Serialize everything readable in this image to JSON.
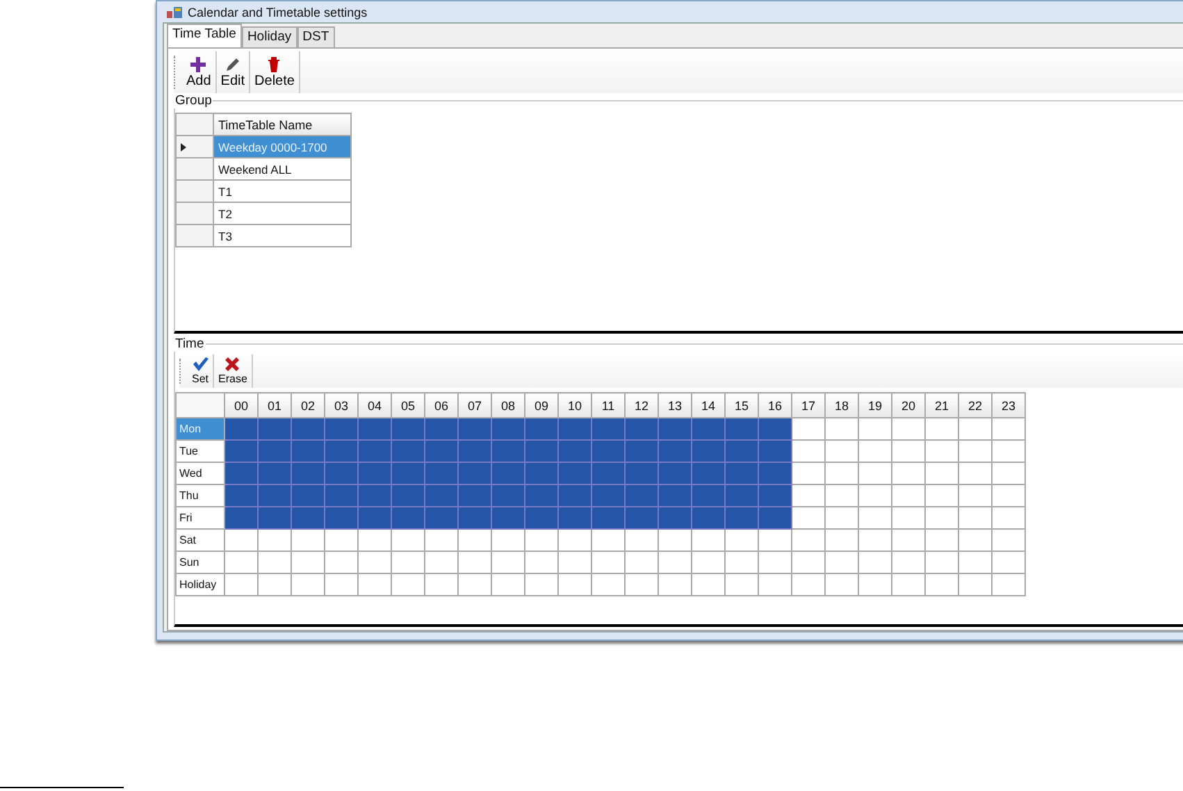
{
  "window": {
    "title": "Calendar and Timetable settings"
  },
  "tabs": [
    {
      "label": "Time Table",
      "selected": true
    },
    {
      "label": "Holiday",
      "selected": false
    },
    {
      "label": "DST",
      "selected": false
    }
  ],
  "toolbar": [
    {
      "kind": "add",
      "label": "Add"
    },
    {
      "kind": "edit",
      "label": "Edit"
    },
    {
      "kind": "delete",
      "label": "Delete"
    }
  ],
  "group": {
    "title": "Group",
    "column": "TimeTable Name",
    "rows": [
      {
        "name": "Weekday 0000-1700",
        "selected": true
      },
      {
        "name": "Weekend ALL",
        "selected": false
      },
      {
        "name": "T1",
        "selected": false
      },
      {
        "name": "T2",
        "selected": false
      },
      {
        "name": "T3",
        "selected": false
      }
    ]
  },
  "time": {
    "title": "Time",
    "toolbar": [
      {
        "kind": "set",
        "label": "Set"
      },
      {
        "kind": "erase",
        "label": "Erase"
      }
    ],
    "hours": [
      "00",
      "01",
      "02",
      "03",
      "04",
      "05",
      "06",
      "07",
      "08",
      "09",
      "10",
      "11",
      "12",
      "13",
      "14",
      "15",
      "16",
      "17",
      "18",
      "19",
      "20",
      "21",
      "22",
      "23"
    ],
    "days": [
      {
        "name": "Mon",
        "selected": true,
        "slots": [
          true,
          true,
          true,
          true,
          true,
          true,
          true,
          true,
          true,
          true,
          true,
          true,
          true,
          true,
          true,
          true,
          true,
          false,
          false,
          false,
          false,
          false,
          false,
          false
        ]
      },
      {
        "name": "Tue",
        "selected": false,
        "slots": [
          true,
          true,
          true,
          true,
          true,
          true,
          true,
          true,
          true,
          true,
          true,
          true,
          true,
          true,
          true,
          true,
          true,
          false,
          false,
          false,
          false,
          false,
          false,
          false
        ]
      },
      {
        "name": "Wed",
        "selected": false,
        "slots": [
          true,
          true,
          true,
          true,
          true,
          true,
          true,
          true,
          true,
          true,
          true,
          true,
          true,
          true,
          true,
          true,
          true,
          false,
          false,
          false,
          false,
          false,
          false,
          false
        ]
      },
      {
        "name": "Thu",
        "selected": false,
        "slots": [
          true,
          true,
          true,
          true,
          true,
          true,
          true,
          true,
          true,
          true,
          true,
          true,
          true,
          true,
          true,
          true,
          true,
          false,
          false,
          false,
          false,
          false,
          false,
          false
        ]
      },
      {
        "name": "Fri",
        "selected": false,
        "slots": [
          true,
          true,
          true,
          true,
          true,
          true,
          true,
          true,
          true,
          true,
          true,
          true,
          true,
          true,
          true,
          true,
          true,
          false,
          false,
          false,
          false,
          false,
          false,
          false
        ]
      },
      {
        "name": "Sat",
        "selected": false,
        "slots": [
          false,
          false,
          false,
          false,
          false,
          false,
          false,
          false,
          false,
          false,
          false,
          false,
          false,
          false,
          false,
          false,
          false,
          false,
          false,
          false,
          false,
          false,
          false,
          false
        ]
      },
      {
        "name": "Sun",
        "selected": false,
        "slots": [
          false,
          false,
          false,
          false,
          false,
          false,
          false,
          false,
          false,
          false,
          false,
          false,
          false,
          false,
          false,
          false,
          false,
          false,
          false,
          false,
          false,
          false,
          false,
          false
        ]
      },
      {
        "name": "Holiday",
        "selected": false,
        "slots": [
          false,
          false,
          false,
          false,
          false,
          false,
          false,
          false,
          false,
          false,
          false,
          false,
          false,
          false,
          false,
          false,
          false,
          false,
          false,
          false,
          false,
          false,
          false,
          false
        ]
      }
    ]
  }
}
